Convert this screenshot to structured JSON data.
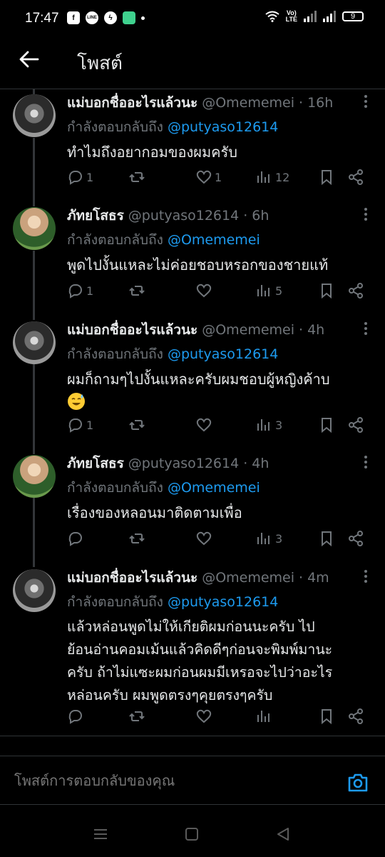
{
  "status_bar": {
    "time": "17:47",
    "line_icon": "LINE",
    "volte": [
      "Vo)",
      "LTE"
    ],
    "battery": "9"
  },
  "header": {
    "title": "โพสต์"
  },
  "reply_prefix": "กำลังตอบกลับถึง",
  "tweets": [
    {
      "display_name": "แม่บอกชื่ออะไรแล้วนะ",
      "handle": "@Omememei",
      "time": "16h",
      "reply_to": "@putyaso12614",
      "text": "ทำไมถึงอยากอมของผมครับ",
      "replies": "1",
      "reposts": "",
      "likes": "1",
      "views": "12",
      "avatar": "dark"
    },
    {
      "display_name": "ภัทยโสธร",
      "handle": "@putyaso12614",
      "time": "6h",
      "reply_to": "@Omememei",
      "text": "พูดไปงั้นแหละไม่ค่อยชอบหรอกของชายแท้",
      "replies": "1",
      "reposts": "",
      "likes": "",
      "views": "5",
      "avatar": "photo"
    },
    {
      "display_name": "แม่บอกชื่ออะไรแล้วนะ",
      "handle": "@Omememei",
      "time": "4h",
      "reply_to": "@putyaso12614",
      "text": "ผมก็ถามๆไปงั้นแหละครับผมชอบผู้หญิงค้าบ",
      "emoji": "sweat-smile-emoji",
      "replies": "1",
      "reposts": "",
      "likes": "",
      "views": "3",
      "avatar": "dark"
    },
    {
      "display_name": "ภัทยโสธร",
      "handle": "@putyaso12614",
      "time": "4h",
      "reply_to": "@Omememei",
      "text": "เรื่องของหลอนมาติดตามเพื่อ",
      "replies": "",
      "reposts": "",
      "likes": "",
      "views": "3",
      "avatar": "photo"
    },
    {
      "display_name": "แม่บอกชื่ออะไรแล้วนะ",
      "handle": "@Omememei",
      "time": "4m",
      "reply_to": "@putyaso12614",
      "text": "แล้วหล่อนพูดไม่ให้เกียติผมก่อนนะครับ ไป\nย้อนอ่านคอมเม้นแล้วคิดดีๆก่อนจะพิมพ์มานะ\nครับ ถ้าไม่แซะผมก่อนผมมีเหรอจะไปว่าอะไร\nหล่อนครับ ผมพูดตรงๆคุยตรงๆครับ",
      "replies": "",
      "reposts": "",
      "likes": "",
      "views": "",
      "avatar": "dark"
    }
  ],
  "composer": {
    "placeholder": "โพสต์การตอบกลับของคุณ"
  },
  "icons": {
    "back": "arrow-left-icon",
    "more": "more-vertical-icon",
    "reply": "reply-icon",
    "repost": "repost-icon",
    "like": "heart-icon",
    "views": "views-icon",
    "bookmark": "bookmark-icon",
    "share": "share-icon",
    "camera": "camera-icon"
  },
  "colors": {
    "accent": "#1d9bf0",
    "muted": "#71767b",
    "background": "#000000",
    "text": "#e7e9ea"
  }
}
